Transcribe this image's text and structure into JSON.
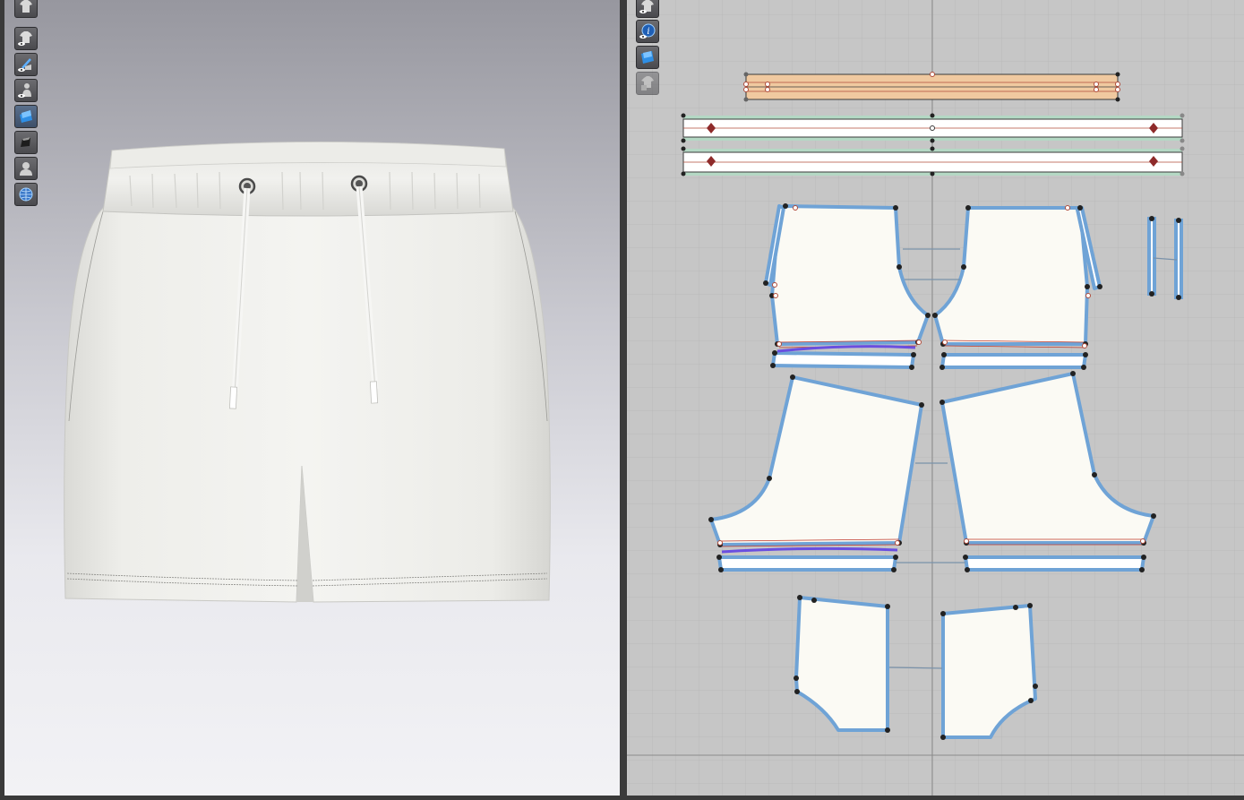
{
  "colors": {
    "fabric": "#f3f3ef",
    "pattern_fill": "#fbfaf4",
    "pattern_outline": "#6fa3d6",
    "waistband_orange": "#f0c9a0",
    "waistband_green": "#b4d8c4",
    "notch_red": "#8e2a2a",
    "grid_bg": "#c6c6c6"
  },
  "viewport3d_toolbar": [
    {
      "name": "avatar-shirt-icon"
    },
    {
      "name": "show-garment-icon"
    },
    {
      "name": "show-pattern-icon"
    },
    {
      "name": "show-avatar-icon"
    },
    {
      "name": "fabric-texture-icon",
      "active": true
    },
    {
      "name": "shading-icon"
    },
    {
      "name": "silhouette-icon"
    },
    {
      "name": "environment-globe-icon"
    }
  ],
  "view2d_toolbar": [
    {
      "name": "show-2d-garment-icon"
    },
    {
      "name": "info-icon"
    },
    {
      "name": "2d-texture-icon"
    },
    {
      "name": "lock-pattern-icon"
    }
  ]
}
